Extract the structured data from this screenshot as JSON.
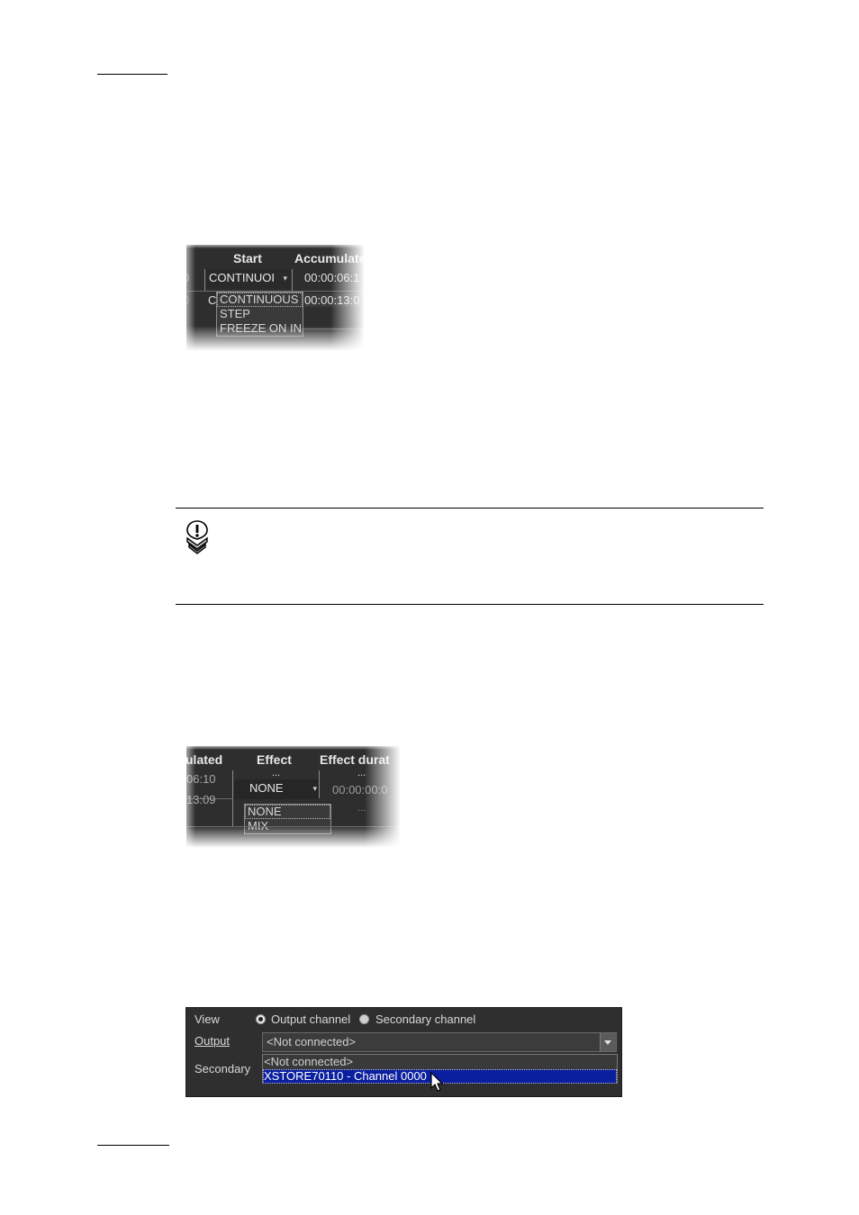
{
  "screenshot1": {
    "columns": [
      "Start",
      "Accumulate"
    ],
    "row1": {
      "left": "0",
      "start_value": "CONTINUOI",
      "accumulated": "00:00:06:1"
    },
    "row2": {
      "left": "0",
      "start_value": "C",
      "accumulated": "00:00:13:0"
    },
    "dropdown_options": [
      "CONTINUOUS",
      "STEP",
      "FREEZE ON IN"
    ]
  },
  "screenshot2": {
    "columns": [
      "ulated",
      "Effect",
      "Effect durat"
    ],
    "row0": {
      "effect": "...",
      "duration": "..."
    },
    "row1": {
      "accumulated": "06:10",
      "effect_value": "NONE",
      "duration": "00:00:00:0"
    },
    "row2": {
      "accumulated": "13:09",
      "duration": "..."
    },
    "dropdown_options": [
      "NONE",
      "MIX"
    ]
  },
  "screenshot3": {
    "view_label": "View",
    "radio_output": "Output channel",
    "radio_secondary": "Secondary channel",
    "output_label": "Output",
    "secondary_label": "Secondary",
    "output_value": "<Not connected>",
    "options": [
      "<Not connected>",
      "XSTORE70110 - Channel 0000"
    ],
    "highlight_color": "#0a1f9e"
  }
}
